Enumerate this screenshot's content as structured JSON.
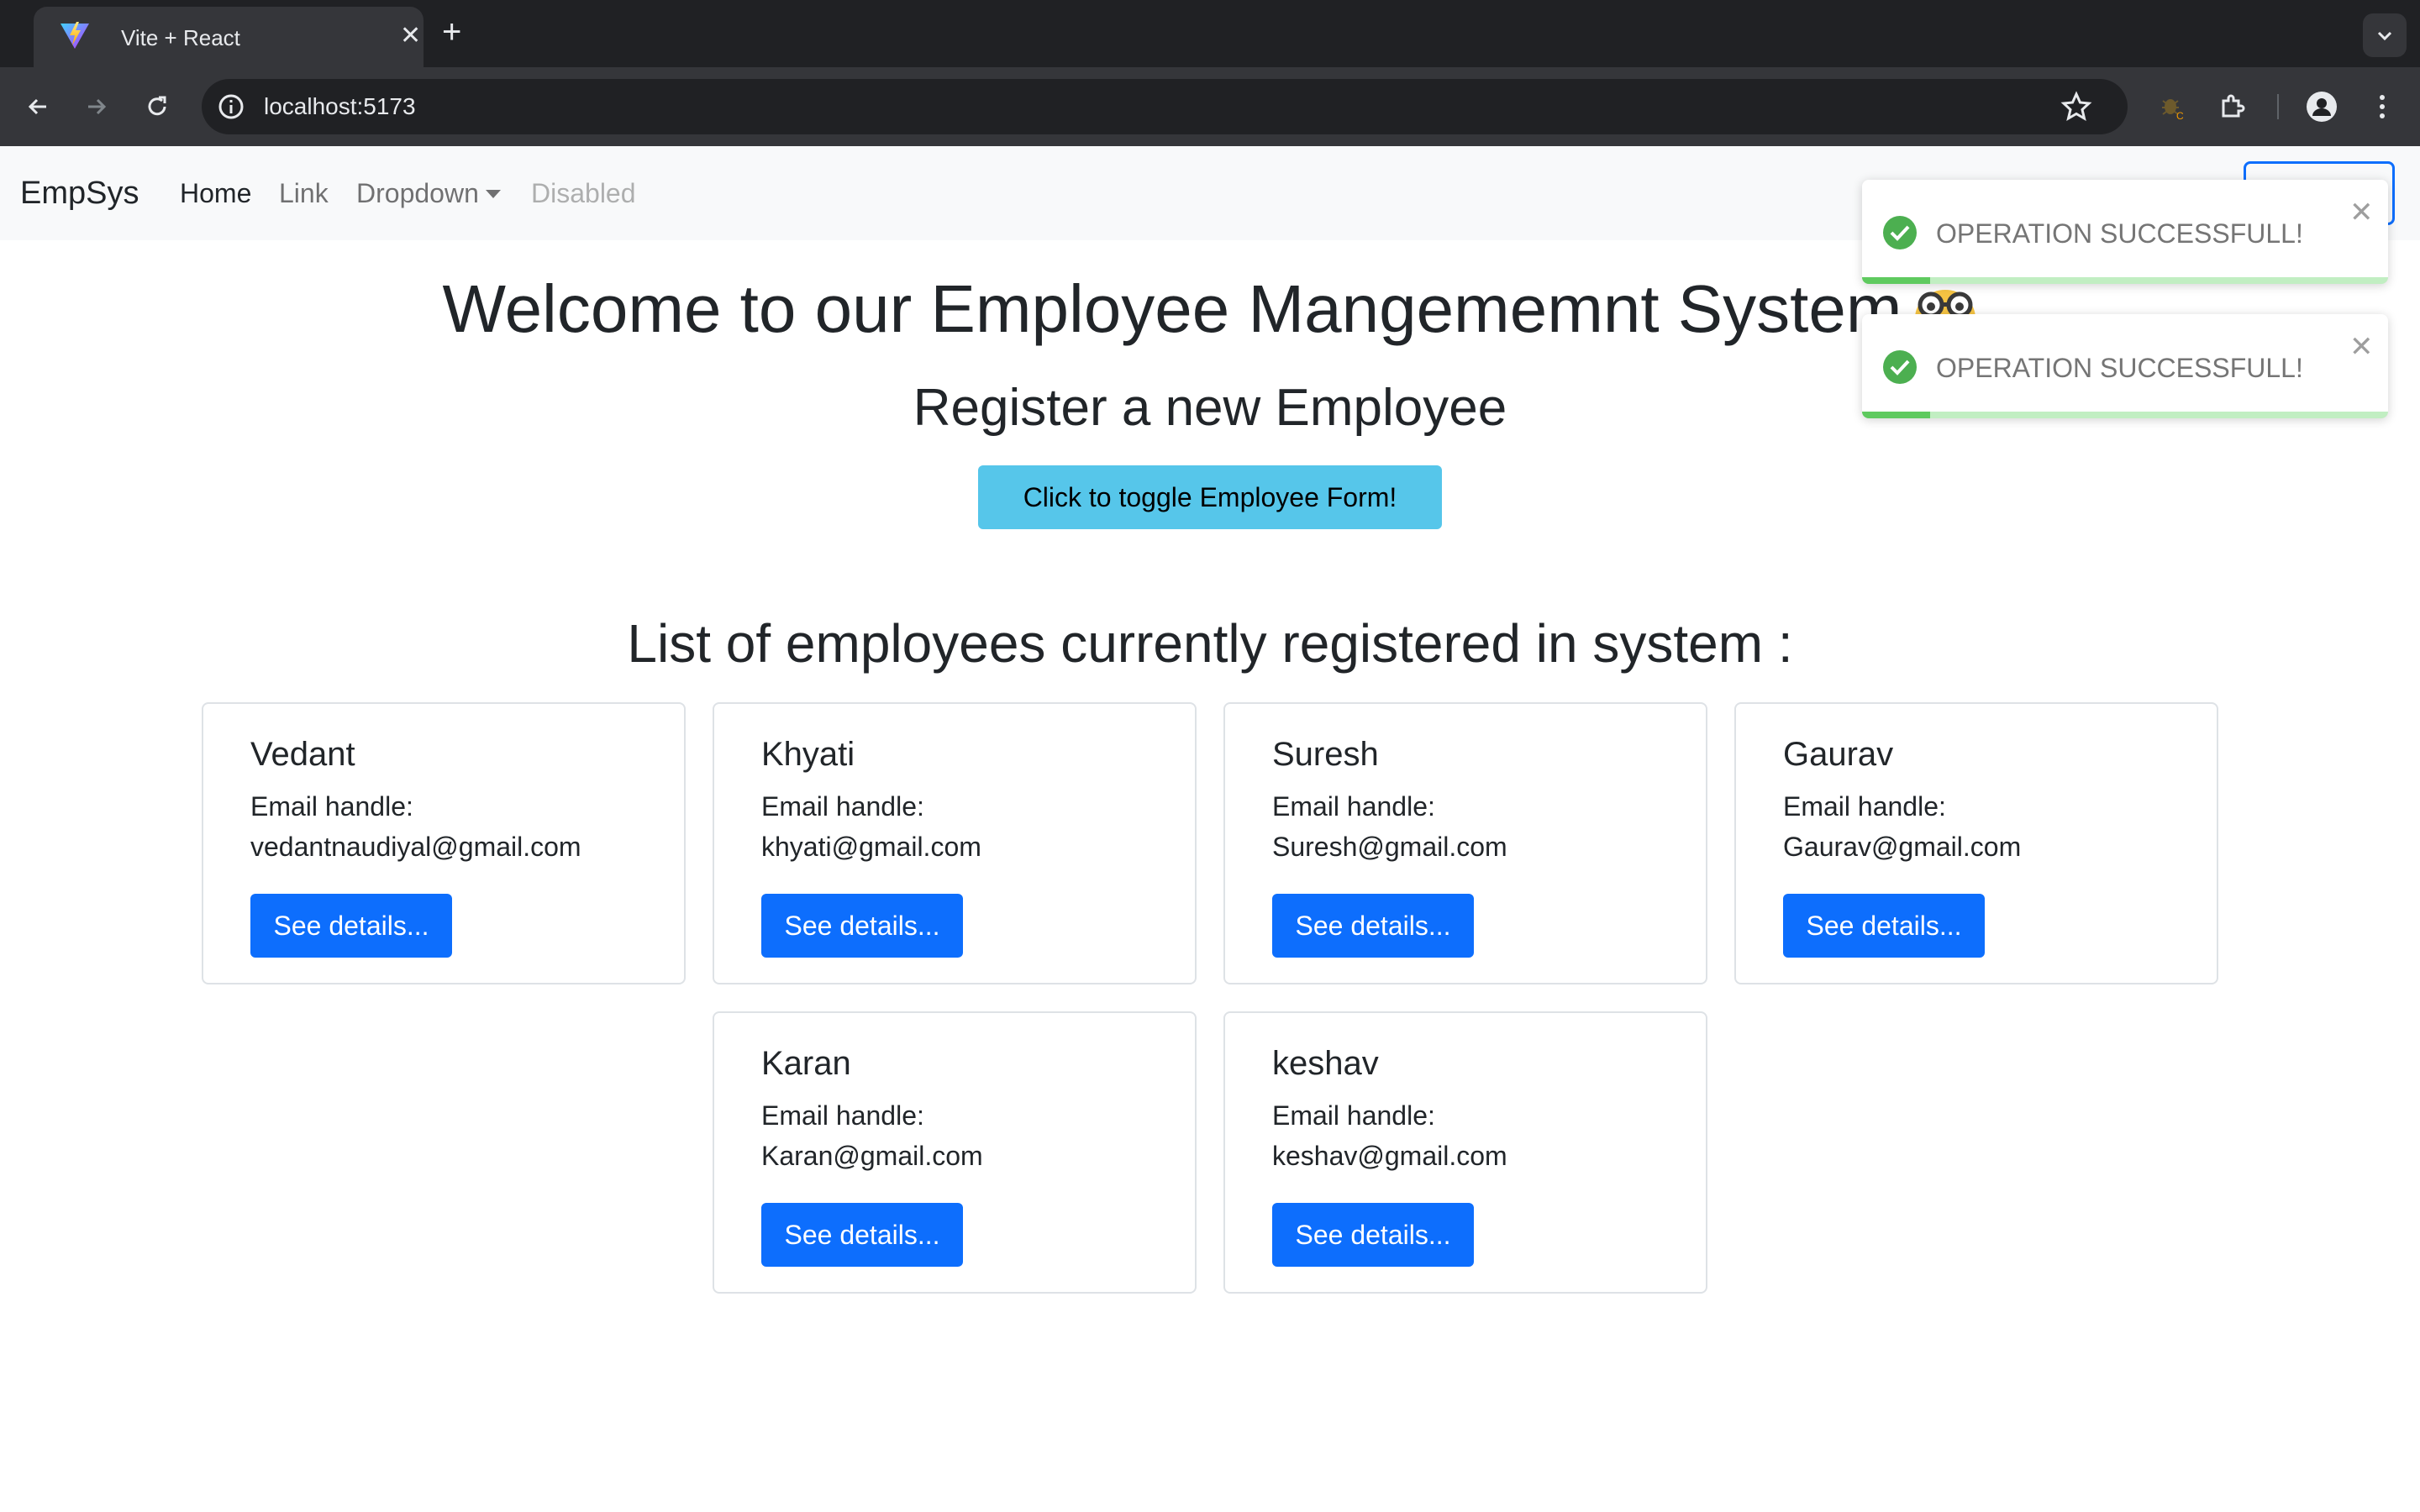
{
  "browser": {
    "tab_title": "Vite + React",
    "tab_close": "✕",
    "new_tab": "+",
    "url": "localhost:5173"
  },
  "navbar": {
    "brand": "EmpSys",
    "links": [
      {
        "label": "Home"
      },
      {
        "label": "Link"
      },
      {
        "label": "Dropdown"
      },
      {
        "label": "Disabled"
      }
    ]
  },
  "main": {
    "heading": "Welcome to our Employee Mangememnt System",
    "heading_emoji": "nerd-face-emoji",
    "subheading": "Register a new Employee",
    "toggle_button": "Click to toggle Employee Form!",
    "list_heading": "List of employees currently registered in system :"
  },
  "employees": [
    {
      "name": "Vedant",
      "label": "Email handle:",
      "email": "vedantnaudiyal@gmail.com",
      "button": "See details..."
    },
    {
      "name": "Khyati",
      "label": "Email handle:",
      "email": "khyati@gmail.com",
      "button": "See details..."
    },
    {
      "name": "Suresh",
      "label": "Email handle:",
      "email": "Suresh@gmail.com",
      "button": "See details..."
    },
    {
      "name": "Gaurav",
      "label": "Email handle:",
      "email": "Gaurav@gmail.com",
      "button": "See details..."
    },
    {
      "name": "Karan",
      "label": "Email handle:",
      "email": "Karan@gmail.com",
      "button": "See details..."
    },
    {
      "name": "keshav",
      "label": "Email handle:",
      "email": "keshav@gmail.com",
      "button": "See details..."
    }
  ],
  "toasts": [
    {
      "message": "OPERATION SUCCESSFULL!",
      "close": "✕",
      "progress": 0.13
    },
    {
      "message": "OPERATION SUCCESSFULL!",
      "close": "✕",
      "progress": 0.13
    }
  ],
  "colors": {
    "primary": "#0d6efd",
    "info": "#56c6ea",
    "success": "#4caf50"
  }
}
